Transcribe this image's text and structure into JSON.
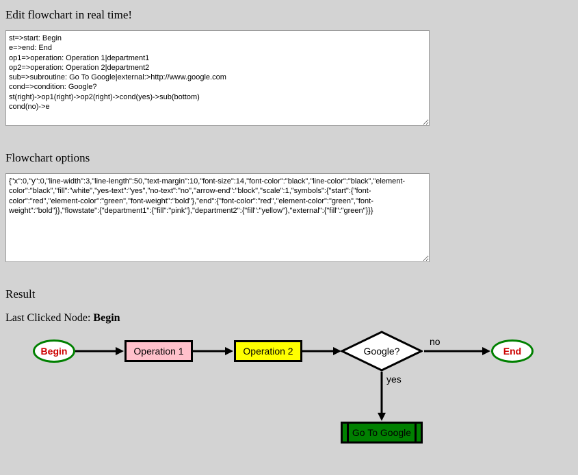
{
  "labels": {
    "edit_title": "Edit flowchart in real time!",
    "options_title": "Flowchart options",
    "result_title": "Result",
    "last_clicked_label": "Last Clicked Node: ",
    "last_clicked_value": "Begin"
  },
  "code_text": "st=>start: Begin\ne=>end: End\nop1=>operation: Operation 1|department1\nop2=>operation: Operation 2|department2\nsub=>subroutine: Go To Google|external:>http://www.google.com\ncond=>condition: Google?\nst(right)->op1(right)->op2(right)->cond(yes)->sub(bottom)\ncond(no)->e",
  "options_text": "{\"x\":0,\"y\":0,\"line-width\":3,\"line-length\":50,\"text-margin\":10,\"font-size\":14,\"font-color\":\"black\",\"line-color\":\"black\",\"element-color\":\"black\",\"fill\":\"white\",\"yes-text\":\"yes\",\"no-text\":\"no\",\"arrow-end\":\"block\",\"scale\":1,\"symbols\":{\"start\":{\"font-color\":\"red\",\"element-color\":\"green\",\"font-weight\":\"bold\"},\"end\":{\"font-color\":\"red\",\"element-color\":\"green\",\"font-weight\":\"bold\"}},\"flowstate\":{\"department1\":{\"fill\":\"pink\"},\"department2\":{\"fill\":\"yellow\"},\"external\":{\"fill\":\"green\"}}}",
  "flowchart": {
    "nodes": {
      "start": "Begin",
      "op1": "Operation 1",
      "op2": "Operation 2",
      "cond": "Google?",
      "sub": "Go To Google",
      "end": "End"
    },
    "edges": {
      "yes": "yes",
      "no": "no"
    }
  }
}
